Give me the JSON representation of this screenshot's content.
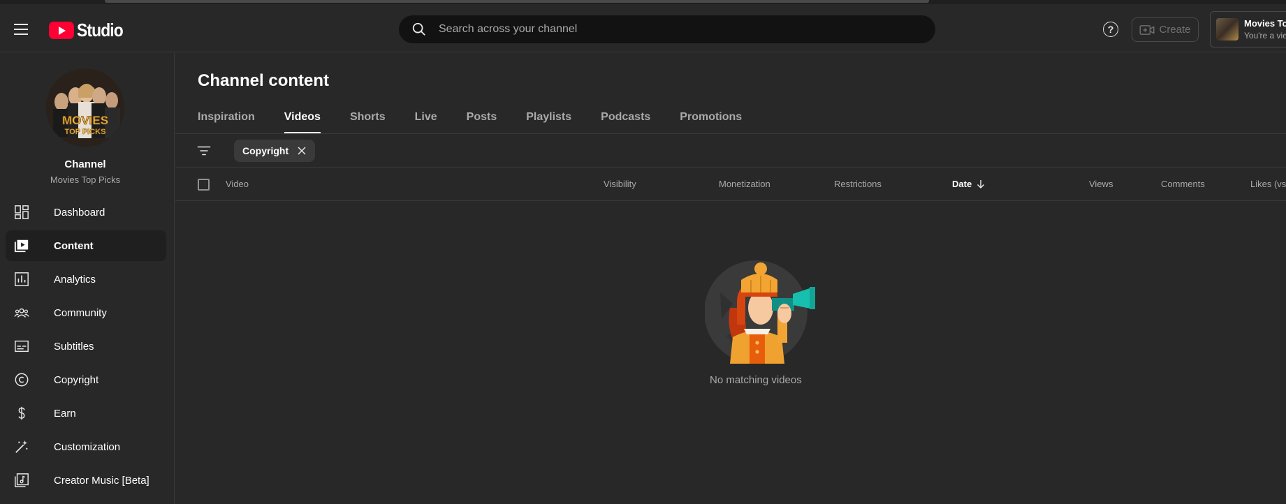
{
  "header": {
    "logo_text": "Studio",
    "search_placeholder": "Search across your channel",
    "help_label": "?",
    "create_label": "Create",
    "account": {
      "name": "Movies Top Picks",
      "subtitle": "You're a viewer"
    }
  },
  "sidebar": {
    "channel_title": "Channel",
    "channel_name": "Movies Top Picks",
    "avatar_text_line1": "MOVIES",
    "avatar_text_line2": "TOP PICKS",
    "items": [
      {
        "label": "Dashboard",
        "icon": "dashboard-icon",
        "active": false
      },
      {
        "label": "Content",
        "icon": "content-icon",
        "active": true
      },
      {
        "label": "Analytics",
        "icon": "analytics-icon",
        "active": false
      },
      {
        "label": "Community",
        "icon": "community-icon",
        "active": false
      },
      {
        "label": "Subtitles",
        "icon": "subtitles-icon",
        "active": false
      },
      {
        "label": "Copyright",
        "icon": "copyright-icon",
        "active": false
      },
      {
        "label": "Earn",
        "icon": "earn-icon",
        "active": false
      },
      {
        "label": "Customization",
        "icon": "customization-icon",
        "active": false
      },
      {
        "label": "Creator Music [Beta]",
        "icon": "creator-music-icon",
        "active": false
      }
    ]
  },
  "main": {
    "title": "Channel content",
    "tabs": [
      {
        "label": "Inspiration",
        "active": false
      },
      {
        "label": "Videos",
        "active": true
      },
      {
        "label": "Shorts",
        "active": false
      },
      {
        "label": "Live",
        "active": false
      },
      {
        "label": "Posts",
        "active": false
      },
      {
        "label": "Playlists",
        "active": false
      },
      {
        "label": "Podcasts",
        "active": false
      },
      {
        "label": "Promotions",
        "active": false
      }
    ],
    "filter_chip": "Copyright",
    "columns": {
      "video": "Video",
      "visibility": "Visibility",
      "monetization": "Monetization",
      "restrictions": "Restrictions",
      "date": "Date",
      "views": "Views",
      "comments": "Comments",
      "likes": "Likes (vs. dislikes)"
    },
    "empty_message": "No matching videos"
  },
  "colors": {
    "background": "#282828",
    "search_bg": "#121212",
    "brand_red": "#ff0033",
    "text_secondary": "#aaaaaa"
  }
}
